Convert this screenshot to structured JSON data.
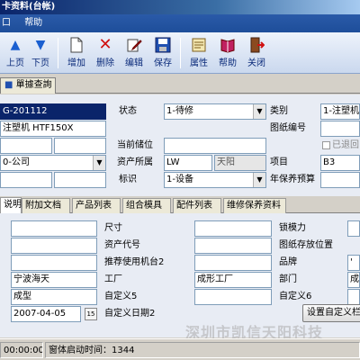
{
  "window": {
    "title": "卡资料(台帐)"
  },
  "menu": {
    "items": [
      "口",
      "帮助"
    ]
  },
  "toolbar": {
    "buttons": [
      {
        "label": "上页",
        "icon": "up-arrow-icon"
      },
      {
        "label": "下页",
        "icon": "down-arrow-icon"
      },
      {
        "label": "增加",
        "icon": "new-document-icon"
      },
      {
        "label": "删除",
        "icon": "delete-x-icon"
      },
      {
        "label": "编辑",
        "icon": "edit-icon"
      },
      {
        "label": "保存",
        "icon": "save-disk-icon"
      },
      {
        "label": "属性",
        "icon": "properties-icon"
      },
      {
        "label": "帮助",
        "icon": "help-book-icon"
      },
      {
        "label": "关闭",
        "icon": "exit-door-icon"
      }
    ]
  },
  "top_tab": {
    "label": "單據查詢"
  },
  "form": {
    "code_value": "G-201112",
    "name_value": "注塑机 HTF150X",
    "company_value": "0-公司",
    "status_label": "状态",
    "status_value": "1-待修",
    "current_location_label": "当前储位",
    "asset_owner_label": "资产所属",
    "asset_owner_code": "LW",
    "asset_owner_name": "天阳",
    "mark_label": "标识",
    "mark_value": "1-设备",
    "category_label": "类别",
    "category_value": "1-注塑机",
    "drawing_no_label": "图纸编号",
    "returned_label": "已退回",
    "project_label": "项目",
    "project_value": "B3",
    "annual_budget_label": "年保养预算"
  },
  "detail_tabs": [
    "说明",
    "附加文档",
    "产品列表",
    "组合模具",
    "配件列表",
    "维修保养资料"
  ],
  "detail": {
    "size_label": "尺寸",
    "asset_code_label": "资产代号",
    "recommend_machine_label": "推荐使用机台2",
    "factory_label": "工厂",
    "custom5_label": "自定义5",
    "custom_date2_label": "自定义日期2",
    "lock_force_label": "锁模力",
    "drawing_location_label": "图纸存放位置",
    "brand_label": "品牌",
    "department_label": "部门",
    "custom6_label": "自定义6",
    "left_values": [
      "",
      "",
      "",
      "宁波海天",
      "成型",
      "2007-04-05"
    ],
    "factory_value": "成形工厂",
    "right_values": [
      "",
      "",
      "",
      "成",
      ""
    ],
    "brand_value": "'",
    "setup_custom_button": "设置自定义栏",
    "cal_label": "15"
  },
  "statusbar": {
    "time": "00:00:00",
    "startup_text": "窗体启动时间：1344"
  },
  "watermark": "深圳市凯信天阳科技"
}
